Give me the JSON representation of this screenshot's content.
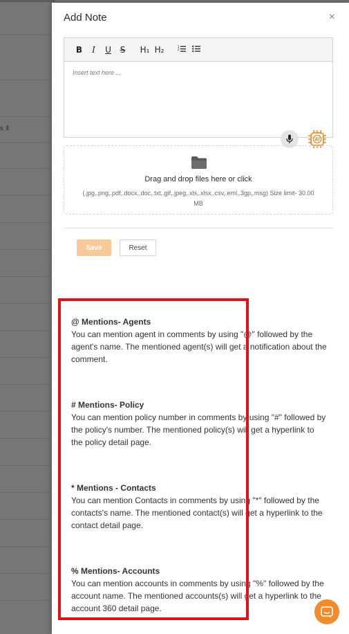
{
  "modal": {
    "title": "Add Note",
    "close_label": "×"
  },
  "toolbar": {
    "bold": "B",
    "italic": "I",
    "underline": "U",
    "strike": "S",
    "h1": "H₁",
    "h2": "H₂",
    "ordered_list": "ordered-list-icon",
    "bullet_list": "bullet-list-icon"
  },
  "editor": {
    "placeholder": "Insert text here ..."
  },
  "upload": {
    "main": "Drag and drop files here or click",
    "formats": "(.jpg,.png,.pdf,.docx,.doc,.txt,.gif,.jpeg,.xls,.xlsx,.csv,.eml,.3gp,.msg) Size limit- 30.00 MB"
  },
  "actions": {
    "save_label": "Save",
    "reset_label": "Reset"
  },
  "backdrop": {
    "sort_label": "s ⇕"
  },
  "mentions": [
    {
      "title": "@ Mentions- Agents",
      "text": "You can mention agent in comments by using \"@\" followed by the agent's name. The mentioned agent(s) will get a notification about the comment."
    },
    {
      "title": "# Mentions- Policy",
      "text": "You can mention policy number in comments by using \"#\" followed by the policy's number. The mentioned policy(s) will get a hyperlink to the policy detail page."
    },
    {
      "title": "* Mentions - Contacts",
      "text": "You can mention Contacts in comments by using \"*\" followed by the contacts's name. The mentioned contact(s) will get a hyperlink to the contact detail page."
    },
    {
      "title": "% Mentions- Accounts",
      "text": "You can mention accounts in comments by using \"%\" followed by the account name. The mentioned accounts(s) will get a hyperlink to the account 360 detail page."
    }
  ],
  "colors": {
    "accent": "#f28b2c",
    "save_bg": "#f8c89a",
    "highlight": "#e31212"
  }
}
